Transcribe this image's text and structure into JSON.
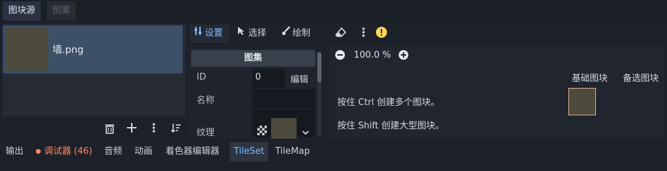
{
  "top_tabs": [
    {
      "label": "图块源",
      "active": true
    },
    {
      "label": "图案",
      "active": false
    }
  ],
  "source": {
    "item_name": "墙.png"
  },
  "left_actions": {
    "delete_icon": "trash-icon",
    "add_icon": "plus-icon",
    "menu_icon": "vertical-dots-icon",
    "sort_icon": "sort-icon"
  },
  "toolbar": {
    "setup_label": "设置",
    "select_label": "选择",
    "paint_label": "绘制",
    "eraser_icon": "eraser-icon",
    "more_icon": "vertical-dots-icon",
    "warning_icon": "warning-icon"
  },
  "inspector": {
    "header": "图集",
    "id_label": "ID",
    "id_value": "0",
    "edit_label": "编辑",
    "name_label": "名称",
    "name_value": "",
    "texture_label": "纹理"
  },
  "viewport": {
    "zoom": "100.0 %",
    "base_tiles_label": "基础图块",
    "alt_tiles_label": "备选图块",
    "hint1": "按住 Ctrl 创建多个图块。",
    "hint2": "按住 Shift 创建大型图块。"
  },
  "bottom_tabs": {
    "output": "输出",
    "debugger": "调试器 (46)",
    "audio": "音频",
    "animation": "动画",
    "shader_editor": "着色器编辑器",
    "tileset": "TileSet",
    "tilemap": "TileMap"
  },
  "colors": {
    "accent": "#7fb9ff",
    "debug_badge": "#ff8a65",
    "selection": "#3c5068",
    "warning": "#ffd84a"
  }
}
